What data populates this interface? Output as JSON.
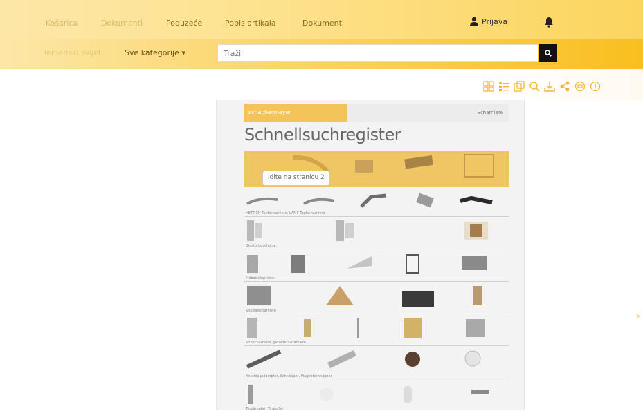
{
  "topnav": {
    "items": [
      "Košarica",
      "Dokumenti",
      "Poduzeće",
      "Popis artikala",
      "Dokumenti"
    ],
    "login_label": "Prijava"
  },
  "searchbar": {
    "faded_label": "lemanski svijet",
    "category_label": "Sve kategorije ▾",
    "search_placeholder": "Traži"
  },
  "toolbar": {
    "icons": [
      "grid-view-icon",
      "list-view-icon",
      "thumbnail-view-icon",
      "zoom-icon",
      "download-icon",
      "share-icon",
      "print-icon",
      "info-icon"
    ]
  },
  "document": {
    "brand_label": "schachermayer",
    "header_right": "Scharniere",
    "title": "Schnellsuchregister",
    "tooltip": "Idite na stranicu 2",
    "row_captions": [
      "HETTICH Topfscharniere, LAMP Topfscharniere",
      "Glastürbeschläge",
      "Möbelscharniere",
      "Spezialscharniere",
      "Stiftscharniere, gerollte Scharniere",
      "Anschlagsdämpfer, Schnäpper, Magnetschnäpper",
      "Türdämpfer, Türpuffer"
    ]
  },
  "colors": {
    "accent": "#f9bf1f",
    "accent_light": "#fde7a8",
    "search_button": "#111111"
  }
}
